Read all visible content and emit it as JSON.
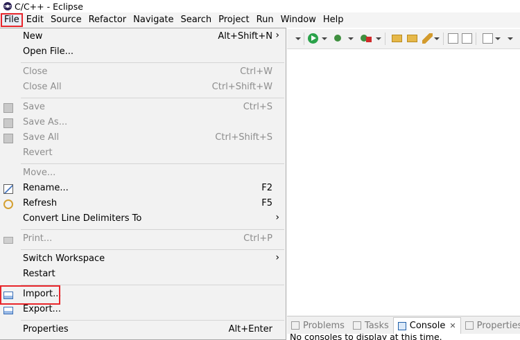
{
  "window": {
    "title": "C/C++ - Eclipse"
  },
  "menubar": {
    "items": [
      "File",
      "Edit",
      "Source",
      "Refactor",
      "Navigate",
      "Search",
      "Project",
      "Run",
      "Window",
      "Help"
    ]
  },
  "file_menu": {
    "new": {
      "label": "New",
      "accel": "Alt+Shift+N",
      "submenu": "›"
    },
    "open_file": {
      "label": "Open File..."
    },
    "close": {
      "label": "Close",
      "accel": "Ctrl+W"
    },
    "close_all": {
      "label": "Close All",
      "accel": "Ctrl+Shift+W"
    },
    "save": {
      "label": "Save",
      "accel": "Ctrl+S"
    },
    "save_as": {
      "label": "Save As..."
    },
    "save_all": {
      "label": "Save All",
      "accel": "Ctrl+Shift+S"
    },
    "revert": {
      "label": "Revert"
    },
    "move": {
      "label": "Move..."
    },
    "rename": {
      "label": "Rename...",
      "accel": "F2"
    },
    "refresh": {
      "label": "Refresh",
      "accel": "F5"
    },
    "convert": {
      "label": "Convert Line Delimiters To",
      "submenu": "›"
    },
    "print": {
      "label": "Print...",
      "accel": "Ctrl+P"
    },
    "switch_workspace": {
      "label": "Switch Workspace",
      "submenu": "›"
    },
    "restart": {
      "label": "Restart"
    },
    "import": {
      "label": "Import..."
    },
    "export": {
      "label": "Export..."
    },
    "properties": {
      "label": "Properties",
      "accel": "Alt+Enter"
    }
  },
  "bottom_panel": {
    "tabs": [
      "Problems",
      "Tasks",
      "Console",
      "Properties"
    ],
    "active_tab": "Console",
    "close_glyph": "✕",
    "console_text": "No consoles to display at this time."
  },
  "colors": {
    "highlight_border": "#e8252a",
    "menu_background": "#f2f2f2",
    "disabled_text": "#8d8d8d"
  }
}
